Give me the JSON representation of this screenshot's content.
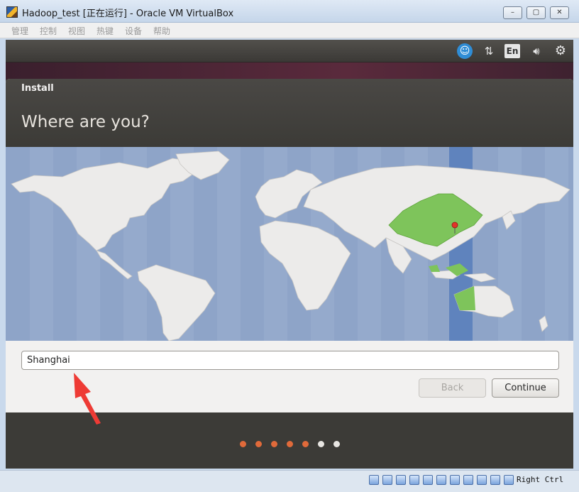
{
  "window": {
    "title": "Hadoop_test [正在运行] - Oracle VM VirtualBox",
    "controls": {
      "minimize": "–",
      "maximize": "▢",
      "close": "✕"
    }
  },
  "menu": [
    "管理",
    "控制",
    "视图",
    "热键",
    "设备",
    "帮助"
  ],
  "guest_topbar": {
    "accessibility_icon": "accessibility-icon",
    "network_icon": "network-arrows-icon",
    "keyboard_language": "En",
    "volume_icon": "volume-icon",
    "settings_icon": "gear-icon"
  },
  "installer": {
    "header": "Install",
    "title": "Where are you?",
    "location": {
      "value": "Shanghai"
    },
    "buttons": {
      "back": "Back",
      "continue": "Continue"
    },
    "progress": {
      "total": 7,
      "completed": 5
    },
    "selected_city_marker": "map-pin-icon"
  },
  "statusbar": {
    "host_key": "Right Ctrl"
  },
  "colors": {
    "map_ocean": "#8ea4c8",
    "land": "#ecebea",
    "selected_region": "#7ec45b",
    "timezone_band": "#5f83bd",
    "progress_active": "#e06a3a",
    "annotation_arrow": "#ee3b35"
  }
}
